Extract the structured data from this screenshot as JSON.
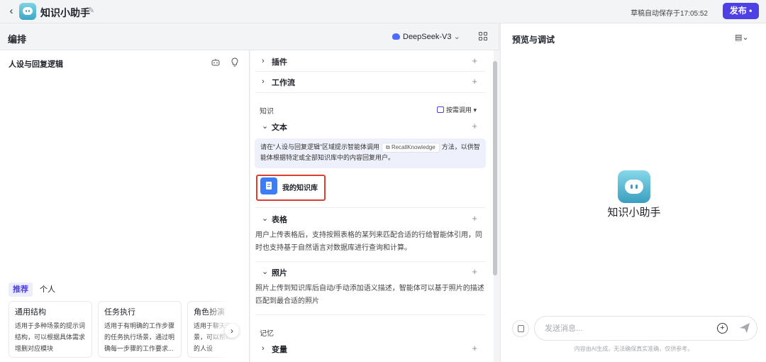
{
  "topbar": {
    "bot_name": "知识小助手",
    "autosave": "草稿自动保存于17:05:52",
    "publish_label": "发布",
    "publish_dot": "•"
  },
  "editor": {
    "title": "编排",
    "model": "DeepSeek-V3",
    "model_chevron": "⌄"
  },
  "persona": {
    "title": "人设与回复逻辑",
    "tabs": [
      "推荐",
      "个人"
    ],
    "cards": [
      {
        "title": "通用结构",
        "desc": "适用于多种场景的提示词结构，可以根据具体需求增删对应模块"
      },
      {
        "title": "任务执行",
        "desc": "适用于有明确的工作步骤的任务执行场景，通过明确每一步骤的工作要求..."
      },
      {
        "title": "角色扮演",
        "desc": "适用于聊天陪伴等娱乐场景，可以帮助塑造个性化的人设"
      }
    ]
  },
  "skills": {
    "plugin": "插件",
    "workflow": "工作流",
    "knowledge_section": "知识",
    "call_mode": "按需调用",
    "text": "文本",
    "hint_before": "请在“人设与回复逻辑”区域提示智能体调用",
    "hint_chip": "RecallKnowledge",
    "hint_after": "方法，以供智能体根据特定或全部知识库中的内容回复用户。",
    "kb_name": "我的知识库",
    "table": "表格",
    "table_desc": "用户上传表格后，支持按照表格的某列来匹配合适的行给智能体引用，同时也支持基于自然语言对数据库进行查询和计算。",
    "photo": "照片",
    "photo_desc": "照片上传到知识库后自动/手动添加语义描述，智能体可以基于照片的描述匹配到最合适的照片",
    "memory_section": "记忆",
    "variable": "变量",
    "plus": "+"
  },
  "preview": {
    "title": "预览与调试",
    "bot_name": "知识小助手",
    "input_placeholder": "发送消息...",
    "disclaimer": "内容由AI生成，无法确保真实准确，仅供参考。"
  },
  "colors": {
    "accent": "#4e40e5",
    "highlight_border": "#d9402f",
    "kb_icon": "#3c7cf6"
  },
  "icons": {
    "back": "chevron-left-icon",
    "edit": "pencil-icon",
    "layout": "grid-icon",
    "persona_1": "optimize-icon",
    "persona_2": "lightbulb-icon",
    "chevron_right": "chevron-right-icon",
    "chevron_down": "chevron-down-icon",
    "send": "send-icon",
    "add": "plus-circle-icon",
    "clear": "clear-history-icon",
    "menu": "file-settings-icon"
  }
}
